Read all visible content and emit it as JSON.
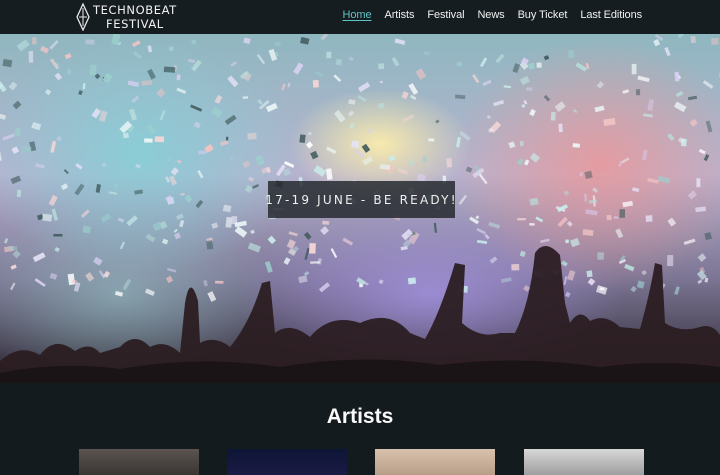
{
  "brand": {
    "line1": "TECHNOBEAT",
    "line2": "FESTIVAL"
  },
  "nav": {
    "items": [
      {
        "label": "Home",
        "active": true
      },
      {
        "label": "Artists",
        "active": false
      },
      {
        "label": "Festival",
        "active": false
      },
      {
        "label": "News",
        "active": false
      },
      {
        "label": "Buy Ticket",
        "active": false
      },
      {
        "label": "Last Editions",
        "active": false
      }
    ]
  },
  "hero": {
    "tagline": "17-19 JUNE - BE READY!"
  },
  "artists": {
    "title": "Artists",
    "cards": [
      {
        "name": "artist-photo-1"
      },
      {
        "name": "artist-photo-2"
      },
      {
        "name": "artist-photo-3"
      },
      {
        "name": "artist-photo-4"
      }
    ]
  },
  "colors": {
    "accent": "#5fc4c6",
    "navbar": "#161d21",
    "page_background": "#141b1f"
  }
}
